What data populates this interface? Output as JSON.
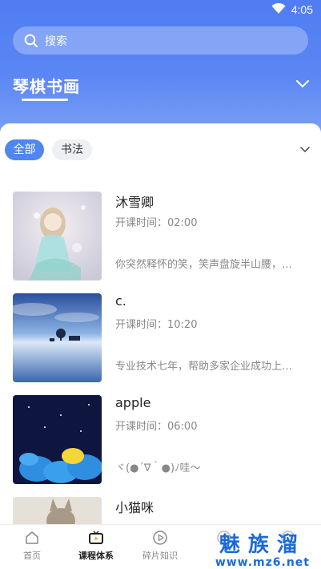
{
  "status_bar": {
    "time": "4:05"
  },
  "search": {
    "placeholder": "搜索"
  },
  "category": {
    "title": "琴棋书画"
  },
  "filters": {
    "all": "全部",
    "calligraphy": "书法"
  },
  "time_prefix": "开课时间：",
  "courses": [
    {
      "name": "沐雪卿",
      "time": "开课时间：02:00",
      "desc": "你突然释怀的笑，笑声盘旋半山腰，随…"
    },
    {
      "name": "c.",
      "time": "开课时间：10:20",
      "desc": "专业技术七年，帮助多家企业成功上线…"
    },
    {
      "name": "apple",
      "time": "开课时间：06:00",
      "desc": "ヾ(●´∇｀●)ﾉ哇～"
    },
    {
      "name": "小猫咪",
      "time": "",
      "desc": ""
    }
  ],
  "tabs": [
    {
      "label": "首页"
    },
    {
      "label": "课程体系"
    },
    {
      "label": "碎片知识"
    },
    {
      "label": ""
    },
    {
      "label": ""
    }
  ],
  "watermark": {
    "main": "魅族溜",
    "sub": "www.mz6.net"
  },
  "colors": {
    "accent": "#4f86f0",
    "hero_top": "#4f7df2",
    "watermark": "#1b6bd6"
  }
}
